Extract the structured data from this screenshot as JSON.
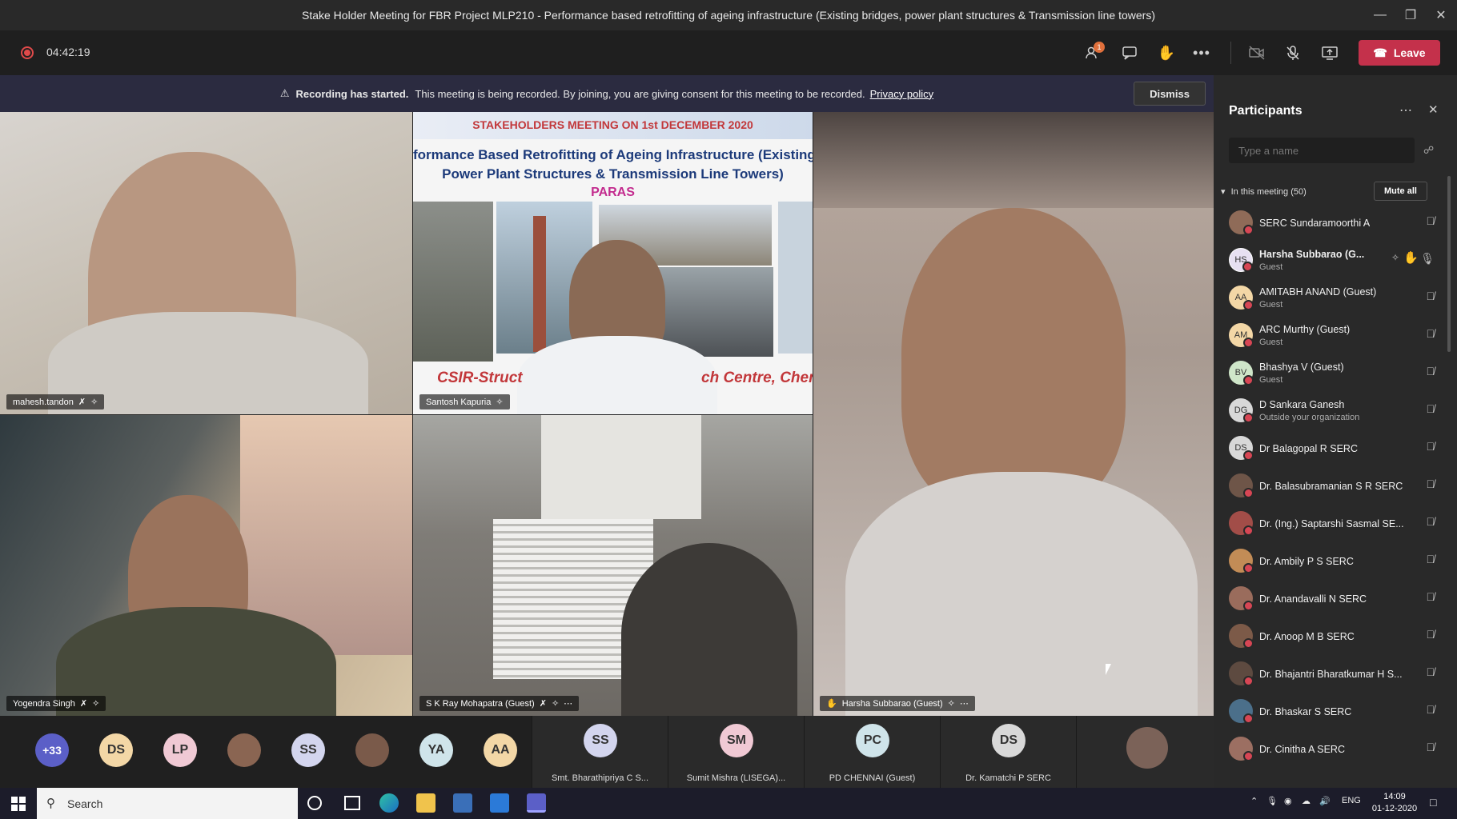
{
  "window": {
    "title": "Stake Holder Meeting for FBR Project MLP210 - Performance based retrofitting of ageing infrastructure (Existing bridges, power plant structures & Transmission line towers)"
  },
  "toolbar": {
    "timer": "04:42:19",
    "participants_badge": "1",
    "leave_label": "Leave"
  },
  "banner": {
    "bold": "Recording has started.",
    "text": "This meeting is being recorded. By joining, you are giving consent for this meeting to be recorded.",
    "link": "Privacy policy",
    "dismiss": "Dismiss"
  },
  "slide": {
    "header": "STAKEHOLDERS MEETING ON 1st DECEMBER 2020",
    "line1": "formance Based Retrofitting of Ageing Infrastructure (Existing",
    "line2": "Power Plant Structures & Transmission Line Towers)",
    "site": "PARAS",
    "footer_left": "CSIR-Struct",
    "footer_right": "ch Centre, Chenn"
  },
  "tiles": [
    {
      "name": "mahesh.tandon"
    },
    {
      "name": "Santosh Kapuria"
    },
    {
      "name": "Harsha Subbarao (Guest)"
    },
    {
      "name": "Yogendra Singh"
    },
    {
      "name": "S K Ray Mohapatra (Guest)"
    }
  ],
  "strip": {
    "overflow": "+33",
    "avatars": [
      "DS",
      "LP",
      "SS",
      "YA",
      "AA"
    ],
    "tiles": [
      {
        "initials": "SS",
        "label": "Smt. Bharathipriya C S..."
      },
      {
        "initials": "SM",
        "label": "Sumit Mishra (LISEGA)..."
      },
      {
        "initials": "PC",
        "label": "PD CHENNAI (Guest)"
      },
      {
        "initials": "DS",
        "label": "Dr. Kamatchi P SERC"
      }
    ]
  },
  "panel": {
    "title": "Participants",
    "search_placeholder": "Type a name",
    "section": "In this meeting (50)",
    "mute_all": "Mute all",
    "participants": [
      {
        "name": "SERC Sundaramoorthi A",
        "sub": "",
        "initials": ""
      },
      {
        "name": "Harsha Subbarao (G...",
        "sub": "Guest",
        "initials": "HS"
      },
      {
        "name": "AMITABH ANAND (Guest)",
        "sub": "Guest",
        "initials": "AA"
      },
      {
        "name": "ARC Murthy (Guest)",
        "sub": "Guest",
        "initials": "AM"
      },
      {
        "name": "Bhashya V (Guest)",
        "sub": "Guest",
        "initials": "BV"
      },
      {
        "name": "D Sankara Ganesh",
        "sub": "Outside your organization",
        "initials": "DG"
      },
      {
        "name": "Dr Balagopal R SERC",
        "sub": "",
        "initials": "DS"
      },
      {
        "name": "Dr. Balasubramanian S R SERC",
        "sub": "",
        "initials": ""
      },
      {
        "name": "Dr. (Ing.) Saptarshi Sasmal SE...",
        "sub": "",
        "initials": ""
      },
      {
        "name": "Dr. Ambily P S SERC",
        "sub": "",
        "initials": ""
      },
      {
        "name": "Dr. Anandavalli N SERC",
        "sub": "",
        "initials": ""
      },
      {
        "name": "Dr. Anoop M B SERC",
        "sub": "",
        "initials": ""
      },
      {
        "name": "Dr. Bhajantri Bharatkumar H S...",
        "sub": "",
        "initials": ""
      },
      {
        "name": "Dr. Bhaskar S SERC",
        "sub": "",
        "initials": ""
      },
      {
        "name": "Dr. Cinitha A SERC",
        "sub": "",
        "initials": ""
      }
    ]
  },
  "taskbar": {
    "search": "Search",
    "lang": "ENG",
    "time": "14:09",
    "date": "01-12-2020"
  }
}
